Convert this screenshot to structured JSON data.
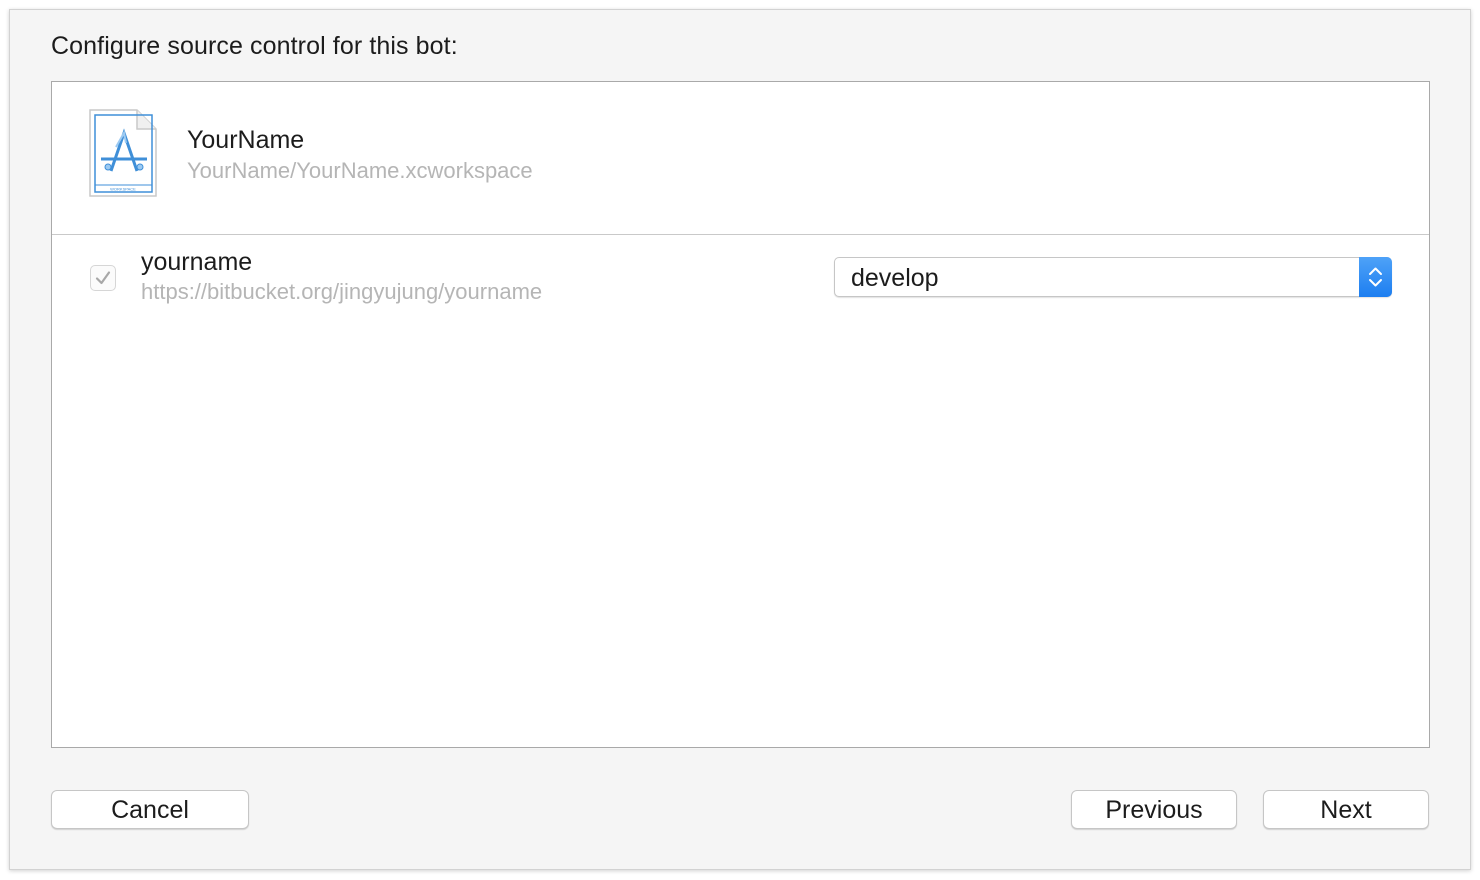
{
  "dialog": {
    "heading": "Configure source control for this bot:"
  },
  "workspace": {
    "name": "YourName",
    "path": "YourName/YourName.xcworkspace",
    "icon": "xcode-workspace-icon",
    "icon_label": "WORKSPACE"
  },
  "repository": {
    "checked": true,
    "name": "yourname",
    "url": "https://bitbucket.org/jingyujung/yourname",
    "branch": "develop"
  },
  "buttons": {
    "cancel": "Cancel",
    "previous": "Previous",
    "next": "Next"
  },
  "colors": {
    "accent": "#1d7ef0",
    "secondary_text": "#b5b5b5",
    "window_background": "#f5f5f5"
  }
}
